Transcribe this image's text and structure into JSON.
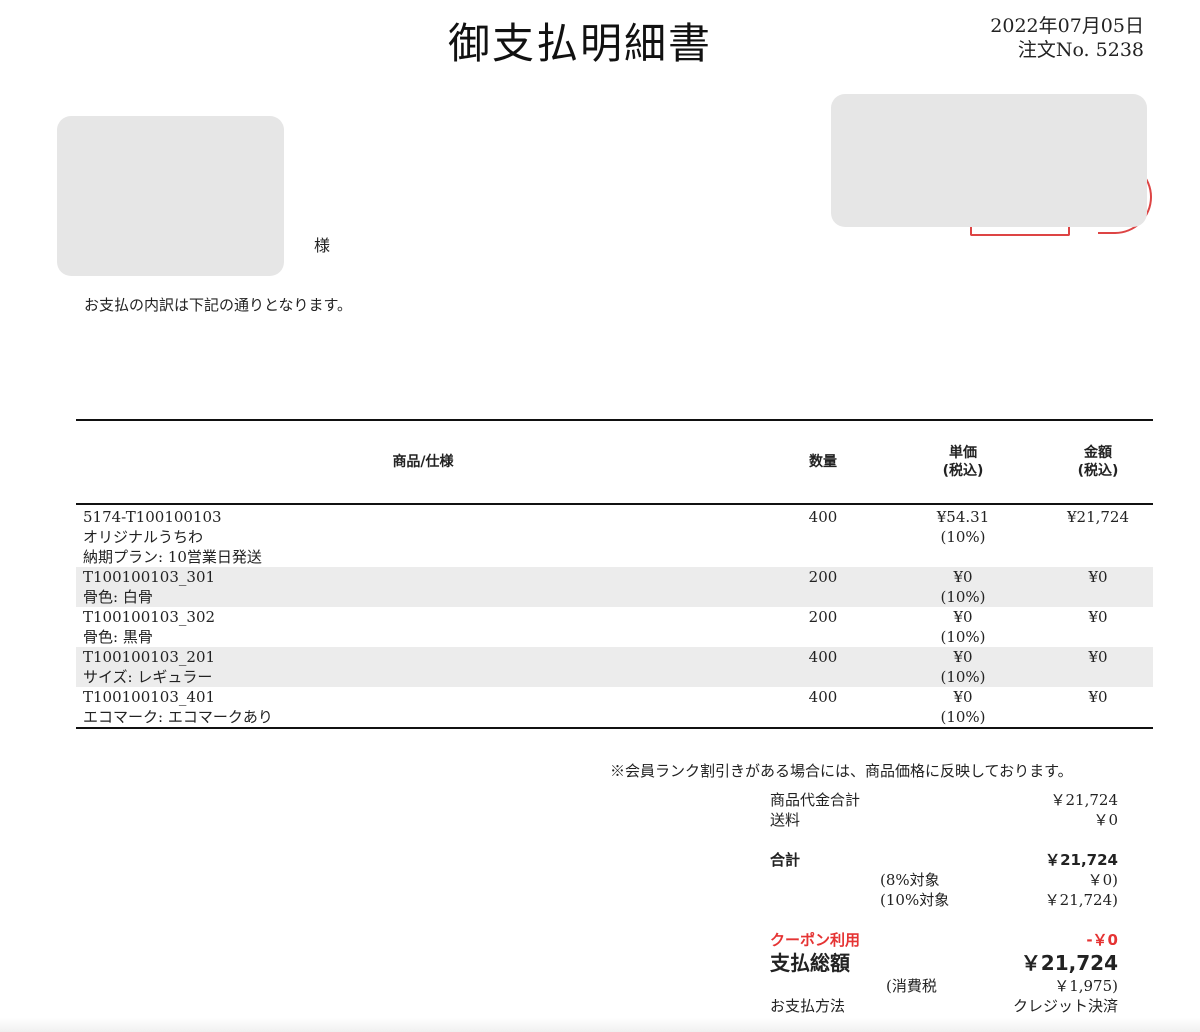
{
  "document": {
    "title": "御支払明細書",
    "date": "2022年07月05日",
    "order_no": "注文No. 5238",
    "customer_suffix": "様",
    "intro": "お支払の内訳は下記の通りとなります。"
  },
  "table": {
    "headers": {
      "name": "商品/仕様",
      "qty": "数量",
      "price_1": "単価",
      "price_2": "(税込)",
      "amount_1": "金額",
      "amount_2": "(税込)"
    },
    "rows": [
      {
        "lines": [
          "5174-T100100103",
          "オリジナルうちわ",
          "納期プラン: 10営業日発送"
        ],
        "qty": "400",
        "price": "¥54.31",
        "tax": "(10%)",
        "amount": "¥21,724"
      },
      {
        "lines": [
          "T100100103_301",
          "骨色: 白骨"
        ],
        "qty": "200",
        "price": "¥0",
        "tax": "(10%)",
        "amount": "¥0"
      },
      {
        "lines": [
          "T100100103_302",
          "骨色: 黒骨"
        ],
        "qty": "200",
        "price": "¥0",
        "tax": "(10%)",
        "amount": "¥0"
      },
      {
        "lines": [
          "T100100103_201",
          "サイズ: レギュラー"
        ],
        "qty": "400",
        "price": "¥0",
        "tax": "(10%)",
        "amount": "¥0"
      },
      {
        "lines": [
          "T100100103_401",
          "エコマーク: エコマークあり"
        ],
        "qty": "400",
        "price": "¥0",
        "tax": "(10%)",
        "amount": "¥0"
      }
    ]
  },
  "note": "※会員ランク割引きがある場合には、商品価格に反映しております。",
  "summary": {
    "subtotal_label": "商品代金合計",
    "subtotal_value": "￥21,724",
    "shipping_label": "送料",
    "shipping_value": "￥0",
    "total_label": "合計",
    "total_value": "￥21,724",
    "tax8_label": "(8%対象",
    "tax8_value": "￥0)",
    "tax10_label": "(10%対象",
    "tax10_value": "￥21,724)",
    "coupon_label": "クーポン利用",
    "coupon_value": "-￥0",
    "grand_label": "支払総額",
    "grand_value": "￥21,724",
    "consumption_tax_label": "(消費税",
    "consumption_tax_value": "￥1,975)",
    "payment_label": "お支払方法",
    "payment_value": "クレジット決済"
  },
  "colors": {
    "redact": "#e6e6e6",
    "row_alt": "#ececec",
    "coupon": "#e53333"
  }
}
